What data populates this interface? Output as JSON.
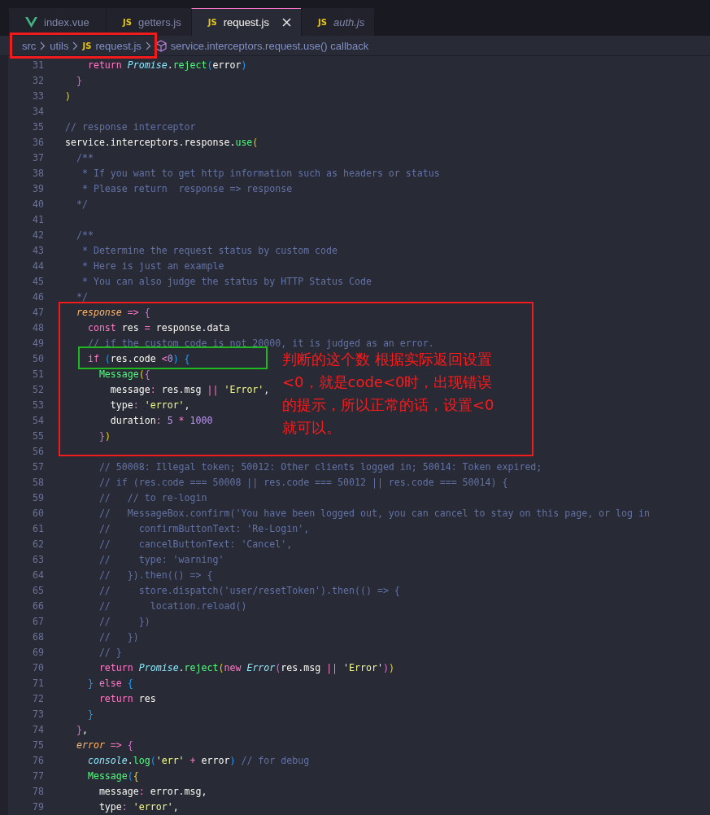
{
  "tabs": [
    {
      "label": "index.vue",
      "kind": "vue",
      "selected": false,
      "preview": false
    },
    {
      "label": "getters.js",
      "kind": "js",
      "badge": "JS",
      "selected": false,
      "preview": false
    },
    {
      "label": "request.js",
      "kind": "js",
      "badge": "JS",
      "selected": true,
      "preview": false
    },
    {
      "label": "auth.js",
      "kind": "js",
      "badge": "JS",
      "selected": false,
      "preview": true
    }
  ],
  "breadcrumb": [
    {
      "label": "src",
      "kind": "folder"
    },
    {
      "label": "utils",
      "kind": "folder"
    },
    {
      "label": "request.js",
      "kind": "file",
      "badge": "JS"
    },
    {
      "label": "service.interceptors.request.use() callback",
      "kind": "symbol"
    }
  ],
  "editor": {
    "lines": [
      {
        "number": "31",
        "tokens": [
          {
            "text": "    return",
            "kind": "kw"
          },
          {
            "text": " Promise",
            "kind": "cls"
          },
          {
            "text": ".",
            "kind": "plain"
          },
          {
            "text": "reject",
            "kind": "fn"
          },
          {
            "text": "(",
            "kind": "b3"
          },
          {
            "text": "error",
            "kind": "plain"
          },
          {
            "text": ")",
            "kind": "b3"
          }
        ]
      },
      {
        "number": "32",
        "tokens": [
          {
            "text": "  }",
            "kind": "b2"
          }
        ]
      },
      {
        "number": "33",
        "tokens": [
          {
            "text": ")",
            "kind": "b1"
          }
        ]
      },
      {
        "number": "34"
      },
      {
        "number": "35",
        "tokens": [
          {
            "text": "// response interceptor",
            "kind": "cmt"
          }
        ]
      },
      {
        "number": "36",
        "tokens": [
          {
            "text": "service.interceptors.response.",
            "kind": "plain"
          },
          {
            "text": "use",
            "kind": "fn"
          },
          {
            "text": "(",
            "kind": "b1"
          }
        ]
      },
      {
        "number": "37",
        "tokens": [
          {
            "text": "  /**",
            "kind": "cmt"
          }
        ]
      },
      {
        "number": "38",
        "tokens": [
          {
            "text": "   * If you want to get http information such as headers or status",
            "kind": "cmt"
          }
        ]
      },
      {
        "number": "39",
        "tokens": [
          {
            "text": "   * Please return  response => response",
            "kind": "cmt"
          }
        ]
      },
      {
        "number": "40",
        "tokens": [
          {
            "text": "  */",
            "kind": "cmt"
          }
        ]
      },
      {
        "number": "41"
      },
      {
        "number": "42",
        "tokens": [
          {
            "text": "  /**",
            "kind": "cmt"
          }
        ]
      },
      {
        "number": "43",
        "tokens": [
          {
            "text": "   * Determine the request status by custom code",
            "kind": "cmt"
          }
        ]
      },
      {
        "number": "44",
        "tokens": [
          {
            "text": "   * Here is just an example",
            "kind": "cmt"
          }
        ]
      },
      {
        "number": "45",
        "tokens": [
          {
            "text": "   * You can also judge the status by HTTP Status Code",
            "kind": "cmt"
          }
        ]
      },
      {
        "number": "46",
        "tokens": [
          {
            "text": "  */",
            "kind": "cmt"
          }
        ]
      },
      {
        "number": "47",
        "tokens": [
          {
            "text": "  response",
            "kind": "param"
          },
          {
            "text": " =>",
            "kind": "op"
          },
          {
            "text": " {",
            "kind": "b2"
          }
        ]
      },
      {
        "number": "48",
        "tokens": [
          {
            "text": "    const",
            "kind": "kw"
          },
          {
            "text": " res ",
            "kind": "plain"
          },
          {
            "text": "=",
            "kind": "op"
          },
          {
            "text": " response.data",
            "kind": "plain"
          }
        ]
      },
      {
        "number": "49",
        "tokens": [
          {
            "text": "    // if the custom code is not 20000, it is judged as an error.",
            "kind": "cmt"
          }
        ]
      },
      {
        "number": "50",
        "tokens": [
          {
            "text": "    if",
            "kind": "kw"
          },
          {
            "text": " (",
            "kind": "b3"
          },
          {
            "text": "res.code ",
            "kind": "plain"
          },
          {
            "text": "<",
            "kind": "op"
          },
          {
            "text": "0",
            "kind": "num"
          },
          {
            "text": ")",
            "kind": "b3"
          },
          {
            "text": " {",
            "kind": "b3"
          }
        ]
      },
      {
        "number": "51",
        "tokens": [
          {
            "text": "      Message",
            "kind": "fn"
          },
          {
            "text": "(",
            "kind": "b1"
          },
          {
            "text": "{",
            "kind": "b2"
          }
        ]
      },
      {
        "number": "52",
        "tokens": [
          {
            "text": "        message",
            "kind": "plain"
          },
          {
            "text": ":",
            "kind": "op"
          },
          {
            "text": " res.msg ",
            "kind": "plain"
          },
          {
            "text": "||",
            "kind": "op"
          },
          {
            "text": " 'Error'",
            "kind": "str"
          },
          {
            "text": ",",
            "kind": "plain"
          }
        ]
      },
      {
        "number": "53",
        "tokens": [
          {
            "text": "        type",
            "kind": "plain"
          },
          {
            "text": ":",
            "kind": "op"
          },
          {
            "text": " 'error'",
            "kind": "str"
          },
          {
            "text": ",",
            "kind": "plain"
          }
        ]
      },
      {
        "number": "54",
        "tokens": [
          {
            "text": "        duration",
            "kind": "plain"
          },
          {
            "text": ":",
            "kind": "op"
          },
          {
            "text": " 5",
            "kind": "num"
          },
          {
            "text": " *",
            "kind": "op"
          },
          {
            "text": " 1000",
            "kind": "num"
          }
        ]
      },
      {
        "number": "55",
        "tokens": [
          {
            "text": "      }",
            "kind": "b2"
          },
          {
            "text": ")",
            "kind": "b1"
          }
        ]
      },
      {
        "number": "56"
      },
      {
        "number": "57",
        "tokens": [
          {
            "text": "      // 50008: Illegal token; 50012: Other clients logged in; 50014: Token expired;",
            "kind": "cmt"
          }
        ]
      },
      {
        "number": "58",
        "tokens": [
          {
            "text": "      // if (res.code === 50008 || res.code === 50012 || res.code === 50014) {",
            "kind": "cmt"
          }
        ]
      },
      {
        "number": "59",
        "tokens": [
          {
            "text": "      //   // to re-login",
            "kind": "cmt"
          }
        ]
      },
      {
        "number": "60",
        "tokens": [
          {
            "text": "      //   MessageBox.confirm('You have been logged out, you can cancel to stay on this page, or log in",
            "kind": "cmt"
          }
        ]
      },
      {
        "number": "61",
        "tokens": [
          {
            "text": "      //     confirmButtonText: 'Re-Login',",
            "kind": "cmt"
          }
        ]
      },
      {
        "number": "62",
        "tokens": [
          {
            "text": "      //     cancelButtonText: 'Cancel',",
            "kind": "cmt"
          }
        ]
      },
      {
        "number": "63",
        "tokens": [
          {
            "text": "      //     type: 'warning'",
            "kind": "cmt"
          }
        ]
      },
      {
        "number": "64",
        "tokens": [
          {
            "text": "      //   }).then(() => {",
            "kind": "cmt"
          }
        ]
      },
      {
        "number": "65",
        "tokens": [
          {
            "text": "      //     store.dispatch('user/resetToken').then(() => {",
            "kind": "cmt"
          }
        ]
      },
      {
        "number": "66",
        "tokens": [
          {
            "text": "      //       location.reload()",
            "kind": "cmt"
          }
        ]
      },
      {
        "number": "67",
        "tokens": [
          {
            "text": "      //     })",
            "kind": "cmt"
          }
        ]
      },
      {
        "number": "68",
        "tokens": [
          {
            "text": "      //   })",
            "kind": "cmt"
          }
        ]
      },
      {
        "number": "69",
        "tokens": [
          {
            "text": "      // }",
            "kind": "cmt"
          }
        ]
      },
      {
        "number": "70",
        "tokens": [
          {
            "text": "      return",
            "kind": "kw"
          },
          {
            "text": " Promise",
            "kind": "cls"
          },
          {
            "text": ".",
            "kind": "plain"
          },
          {
            "text": "reject",
            "kind": "fn"
          },
          {
            "text": "(",
            "kind": "b1"
          },
          {
            "text": "new",
            "kind": "kw"
          },
          {
            "text": " Error",
            "kind": "cls"
          },
          {
            "text": "(",
            "kind": "b2"
          },
          {
            "text": "res.msg ",
            "kind": "plain"
          },
          {
            "text": "||",
            "kind": "op"
          },
          {
            "text": " 'Error'",
            "kind": "str"
          },
          {
            "text": ")",
            "kind": "b2"
          },
          {
            "text": ")",
            "kind": "b1"
          }
        ]
      },
      {
        "number": "71",
        "tokens": [
          {
            "text": "    }",
            "kind": "b3"
          },
          {
            "text": " else",
            "kind": "kw"
          },
          {
            "text": " {",
            "kind": "b3"
          }
        ]
      },
      {
        "number": "72",
        "tokens": [
          {
            "text": "      return",
            "kind": "kw"
          },
          {
            "text": " res",
            "kind": "plain"
          }
        ]
      },
      {
        "number": "73",
        "tokens": [
          {
            "text": "    }",
            "kind": "b3"
          }
        ]
      },
      {
        "number": "74",
        "tokens": [
          {
            "text": "  }",
            "kind": "b2"
          },
          {
            "text": ",",
            "kind": "plain"
          }
        ]
      },
      {
        "number": "75",
        "tokens": [
          {
            "text": "  error",
            "kind": "param"
          },
          {
            "text": " =>",
            "kind": "op"
          },
          {
            "text": " {",
            "kind": "b2"
          }
        ]
      },
      {
        "number": "76",
        "tokens": [
          {
            "text": "    console",
            "kind": "cls"
          },
          {
            "text": ".",
            "kind": "plain"
          },
          {
            "text": "log",
            "kind": "fn"
          },
          {
            "text": "(",
            "kind": "b3"
          },
          {
            "text": "'err'",
            "kind": "str"
          },
          {
            "text": " +",
            "kind": "op"
          },
          {
            "text": " error",
            "kind": "plain"
          },
          {
            "text": ")",
            "kind": "b3"
          },
          {
            "text": " // for debug",
            "kind": "cmt"
          }
        ]
      },
      {
        "number": "77",
        "tokens": [
          {
            "text": "    Message",
            "kind": "fn"
          },
          {
            "text": "(",
            "kind": "b3"
          },
          {
            "text": "{",
            "kind": "b1"
          }
        ]
      },
      {
        "number": "78",
        "tokens": [
          {
            "text": "      message",
            "kind": "plain"
          },
          {
            "text": ":",
            "kind": "op"
          },
          {
            "text": " error.msg,",
            "kind": "plain"
          }
        ]
      },
      {
        "number": "79",
        "tokens": [
          {
            "text": "      type",
            "kind": "plain"
          },
          {
            "text": ":",
            "kind": "op"
          },
          {
            "text": " 'error'",
            "kind": "str"
          },
          {
            "text": ",",
            "kind": "plain"
          }
        ]
      }
    ]
  },
  "note_lines": [
    "判断的这个数 根据实际返回设置",
    "<0，就是code<0时，出现错误",
    "的提示，所以正常的话，设置<0",
    "就可以。"
  ]
}
